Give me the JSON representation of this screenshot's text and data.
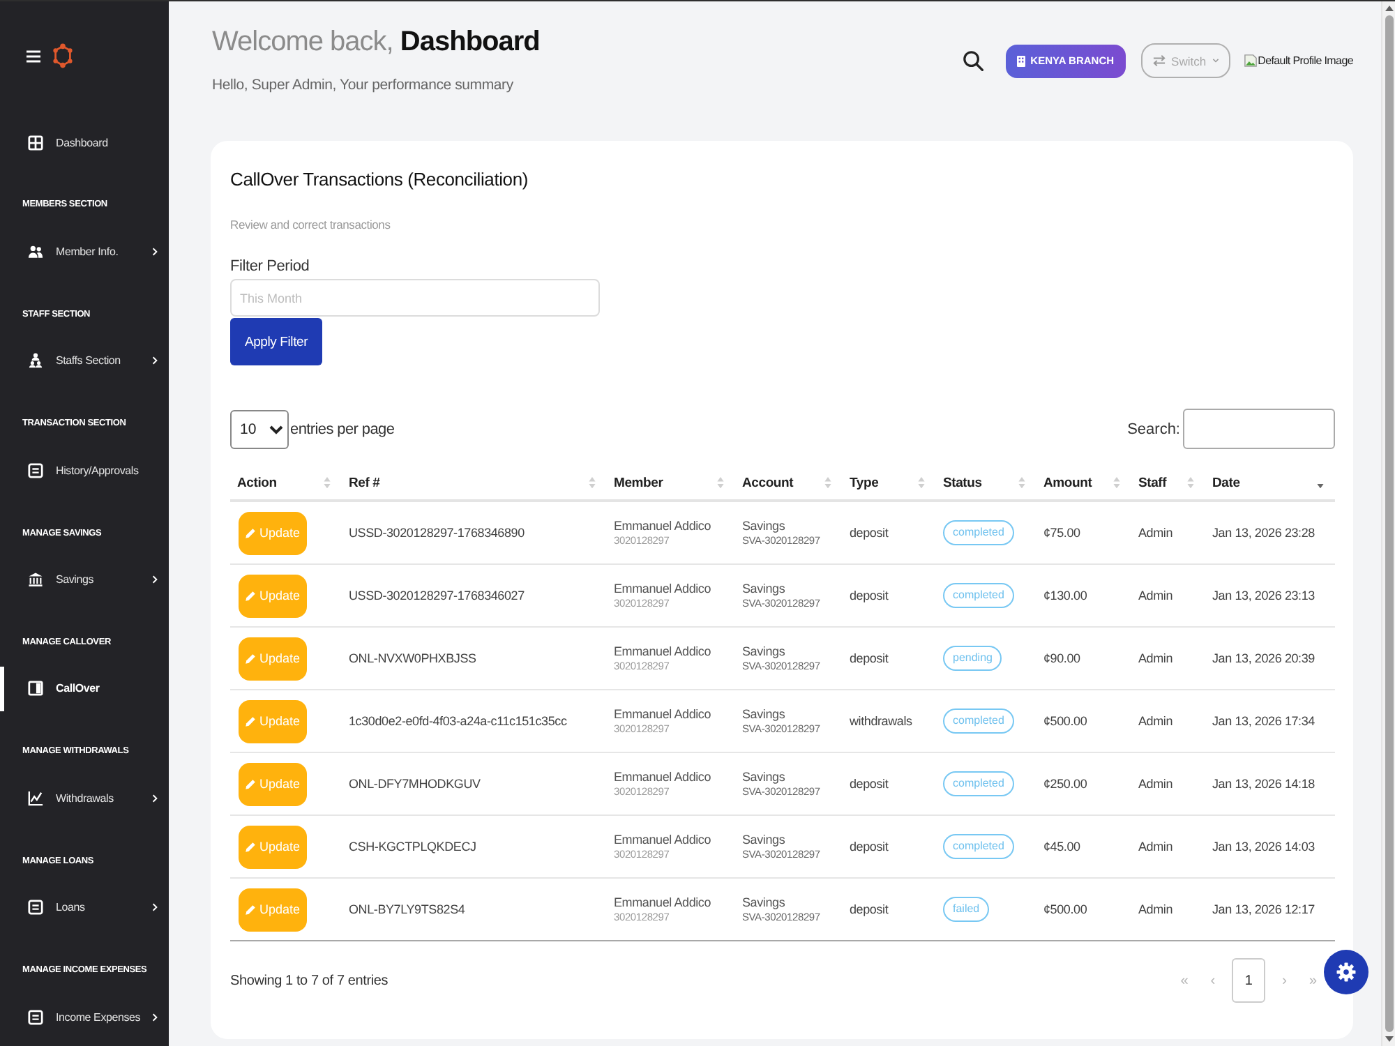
{
  "sidebar": {
    "nav": [
      {
        "kind": "link",
        "label": "Dashboard",
        "selected": false,
        "expandable": false
      },
      {
        "kind": "heading",
        "label": "MEMBERS SECTION"
      },
      {
        "kind": "link",
        "label": "Member Info.",
        "selected": false,
        "expandable": true
      },
      {
        "kind": "heading",
        "label": "STAFF SECTION"
      },
      {
        "kind": "link",
        "label": "Staffs Section",
        "selected": false,
        "expandable": true
      },
      {
        "kind": "heading",
        "label": "TRANSACTION SECTION"
      },
      {
        "kind": "link",
        "label": "History/Approvals",
        "selected": false,
        "expandable": false
      },
      {
        "kind": "heading",
        "label": "MANAGE SAVINGS"
      },
      {
        "kind": "link",
        "label": "Savings",
        "selected": false,
        "expandable": true
      },
      {
        "kind": "heading",
        "label": "MANAGE CALLOVER"
      },
      {
        "kind": "link",
        "label": "CallOver",
        "selected": true,
        "expandable": false
      },
      {
        "kind": "heading",
        "label": "MANAGE WITHDRAWALS"
      },
      {
        "kind": "link",
        "label": "Withdrawals",
        "selected": false,
        "expandable": true
      },
      {
        "kind": "heading",
        "label": "MANAGE LOANS"
      },
      {
        "kind": "link",
        "label": "Loans",
        "selected": false,
        "expandable": true
      },
      {
        "kind": "heading",
        "label": "MANAGE INCOME EXPENSES"
      },
      {
        "kind": "link",
        "label": "Income Expenses",
        "selected": false,
        "expandable": true
      }
    ]
  },
  "header": {
    "greeting": "Welcome back, **Dashboard**",
    "subtitle": "Hello, Super Admin, Your performance summary",
    "branch_badge": "KENYA BRANCH",
    "switch_button": "Switch",
    "profile_image_alt": "Default Profile Image"
  },
  "card": {
    "title": "CallOver Transactions (Reconciliation)",
    "description": "Review and correct transactions",
    "filter": {
      "label": "Filter Period",
      "placeholder": "This Month",
      "button": "Apply Filter"
    },
    "controls": {
      "page_size": "10",
      "page_size_label": "entries per page",
      "search_label": "Search:"
    },
    "table": {
      "columns": [
        {
          "label": "Action",
          "sorted": false
        },
        {
          "label": "Ref #",
          "sorted": false
        },
        {
          "label": "Member",
          "sorted": false
        },
        {
          "label": "Account",
          "sorted": false
        },
        {
          "label": "Type",
          "sorted": false
        },
        {
          "label": "Status",
          "sorted": false
        },
        {
          "label": "Amount",
          "sorted": false
        },
        {
          "label": "Staff",
          "sorted": false
        },
        {
          "label": "Date",
          "sorted": true
        }
      ],
      "rows": [
        {
          "action": "Update",
          "ref": "USSD-3020128297-1768346890",
          "member": "Emmanuel Addico",
          "member_id": "3020128297",
          "account": "Savings",
          "account_number": "SVA-3020128297",
          "type": "deposit",
          "status": "completed",
          "amount": "¢75.00",
          "staff": "Admin",
          "date": "Jan 13, 2026 23:28"
        },
        {
          "action": "Update",
          "ref": "USSD-3020128297-1768346027",
          "member": "Emmanuel Addico",
          "member_id": "3020128297",
          "account": "Savings",
          "account_number": "SVA-3020128297",
          "type": "deposit",
          "status": "completed",
          "amount": "¢130.00",
          "staff": "Admin",
          "date": "Jan 13, 2026 23:13"
        },
        {
          "action": "Update",
          "ref": "ONL-NVXW0PHXBJSS",
          "member": "Emmanuel Addico",
          "member_id": "3020128297",
          "account": "Savings",
          "account_number": "SVA-3020128297",
          "type": "deposit",
          "status": "pending",
          "amount": "¢90.00",
          "staff": "Admin",
          "date": "Jan 13, 2026 20:39"
        },
        {
          "action": "Update",
          "ref": "1c30d0e2-e0fd-4f03-a24a-c11c151c35cc",
          "member": "Emmanuel Addico",
          "member_id": "3020128297",
          "account": "Savings",
          "account_number": "SVA-3020128297",
          "type": "withdrawals",
          "status": "completed",
          "amount": "¢500.00",
          "staff": "Admin",
          "date": "Jan 13, 2026 17:34"
        },
        {
          "action": "Update",
          "ref": "ONL-DFY7MHODKGUV",
          "member": "Emmanuel Addico",
          "member_id": "3020128297",
          "account": "Savings",
          "account_number": "SVA-3020128297",
          "type": "deposit",
          "status": "completed",
          "amount": "¢250.00",
          "staff": "Admin",
          "date": "Jan 13, 2026 14:18"
        },
        {
          "action": "Update",
          "ref": "CSH-KGCTPLQKDECJ",
          "member": "Emmanuel Addico",
          "member_id": "3020128297",
          "account": "Savings",
          "account_number": "SVA-3020128297",
          "type": "deposit",
          "status": "completed",
          "amount": "¢45.00",
          "staff": "Admin",
          "date": "Jan 13, 2026 14:03"
        },
        {
          "action": "Update",
          "ref": "ONL-BY7LY9TS82S4",
          "member": "Emmanuel Addico",
          "member_id": "3020128297",
          "account": "Savings",
          "account_number": "SVA-3020128297",
          "type": "deposit",
          "status": "failed",
          "amount": "¢500.00",
          "staff": "Admin",
          "date": "Jan 13, 2026 12:17"
        }
      ]
    },
    "footer": {
      "info": "Showing 1 to 7 of 7 entries",
      "pagination": [
        {
          "label": "«",
          "selected": false,
          "disabled": true
        },
        {
          "label": "‹",
          "selected": false,
          "disabled": true
        },
        {
          "label": "1",
          "selected": true,
          "disabled": false
        },
        {
          "label": "›",
          "selected": false,
          "disabled": true
        },
        {
          "label": "»",
          "selected": false,
          "disabled": true
        }
      ]
    }
  }
}
